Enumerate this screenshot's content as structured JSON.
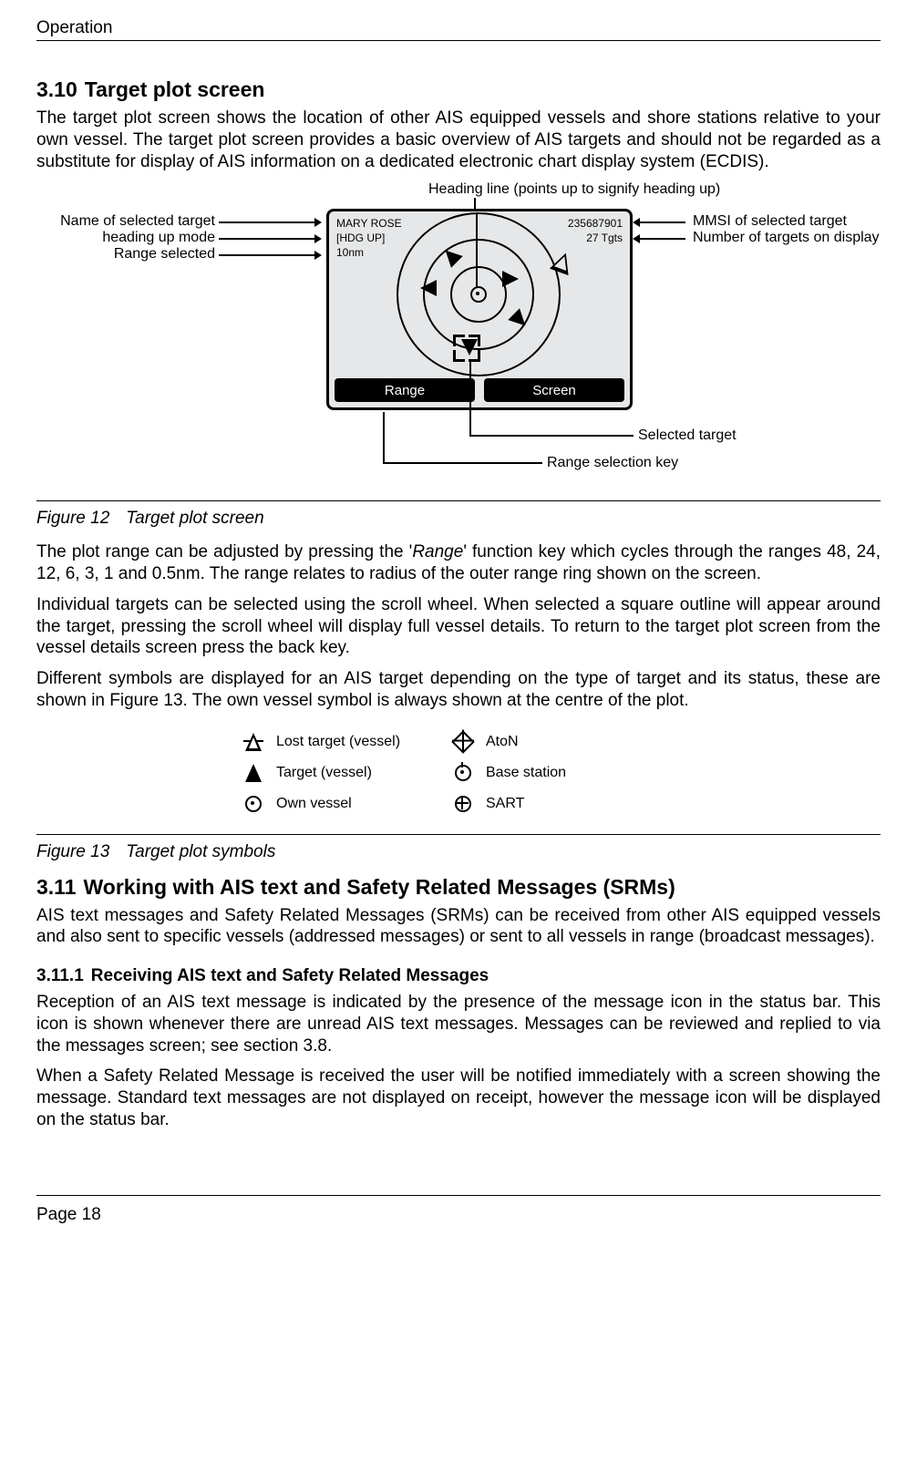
{
  "header": {
    "chapter": "Operation"
  },
  "section_310": {
    "num": "3.10",
    "title": "Target plot screen",
    "p1": "The target plot screen shows the location of other AIS equipped vessels and shore stations relative to your own vessel. The target plot screen provides a basic overview of AIS targets and should not be regarded as a substitute for display of AIS information on a dedicated electronic chart display system (ECDIS)."
  },
  "fig12": {
    "caption_num": "Figure 12",
    "caption_txt": "Target plot screen",
    "lcd": {
      "name": "MARY ROSE",
      "mode": "[HDG UP]",
      "range": "10nm",
      "mmsi": "235687901",
      "target_count": "27  Tgts",
      "softkey_left": "Range",
      "softkey_right": "Screen"
    },
    "callouts": {
      "left1": "Name of selected target",
      "left2": "heading up mode",
      "left3": "Range selected",
      "top": "Heading line (points up to signify heading up)",
      "right1": "MMSI of selected target",
      "right2": "Number of targets on display",
      "right3": "Selected target",
      "bottom": "Range selection key"
    }
  },
  "para_block2": {
    "p1a": "The plot range can be adjusted by pressing the '",
    "p1i": "Range",
    "p1b": "' function key which cycles through the ranges 48, 24, 12, 6, 3, 1 and 0.5nm. The range relates to radius of the outer range ring shown on the screen.",
    "p2": "Individual targets can be selected using the scroll wheel. When selected a square outline will appear around the target, pressing the scroll wheel will display full vessel details. To return to the target plot screen from the vessel details screen press the back key.",
    "p3": "Different symbols are displayed for an AIS target depending on the type of target and its status, these are shown in Figure 13. The own vessel symbol is always shown at the centre of the plot."
  },
  "fig13": {
    "caption_num": "Figure 13",
    "caption_txt": "Target plot symbols",
    "legend": {
      "lost_target": "Lost target (vessel)",
      "target": "Target (vessel)",
      "own_vessel": "Own vessel",
      "aton": "AtoN",
      "base_station": "Base station",
      "sart": "SART"
    }
  },
  "section_311": {
    "num": "3.11",
    "title": "Working with AIS text and Safety Related Messages (SRMs)",
    "p1": "AIS text messages and Safety Related Messages (SRMs) can be received from other AIS equipped vessels and also sent to specific vessels (addressed messages) or sent to all vessels in range (broadcast messages)."
  },
  "section_3111": {
    "num": "3.11.1",
    "title": "Receiving AIS text and Safety Related Messages",
    "p1": "Reception of an AIS text message is indicated by the presence of the message icon in the status bar. This icon is shown whenever there are unread AIS text messages. Messages can be reviewed and replied to via the messages screen; see section 3.8.",
    "p2": "When a Safety Related Message is received the user will be notified immediately with a screen showing the message. Standard text messages are not displayed on receipt, however the message icon will be displayed on the status bar."
  },
  "footer": {
    "page": "Page 18"
  }
}
